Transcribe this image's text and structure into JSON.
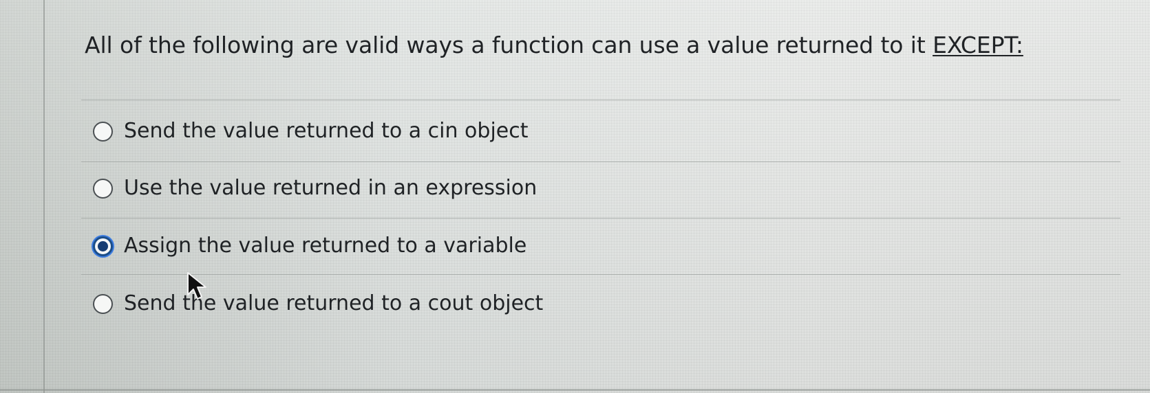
{
  "question": {
    "prompt": "All of the following are valid ways a function can use a value returned to it ",
    "emphasis": "EXCEPT:",
    "options": [
      {
        "label": "Send the value returned to a cin object",
        "selected": false
      },
      {
        "label": "Use the value returned in an expression",
        "selected": false
      },
      {
        "label": "Assign the value returned to a variable",
        "selected": true
      },
      {
        "label": "Send the value returned to a cout object",
        "selected": false
      }
    ]
  },
  "colors": {
    "background": "#d8dcda",
    "text": "#1f2225",
    "divider": "#9fa4a1",
    "selected_radio": "#163c73",
    "selected_ring": "#3b7be0"
  },
  "icons": {
    "radio": "radio-button",
    "selected_radio": "radio-button-selected",
    "pointer": "mouse-pointer-icon"
  }
}
